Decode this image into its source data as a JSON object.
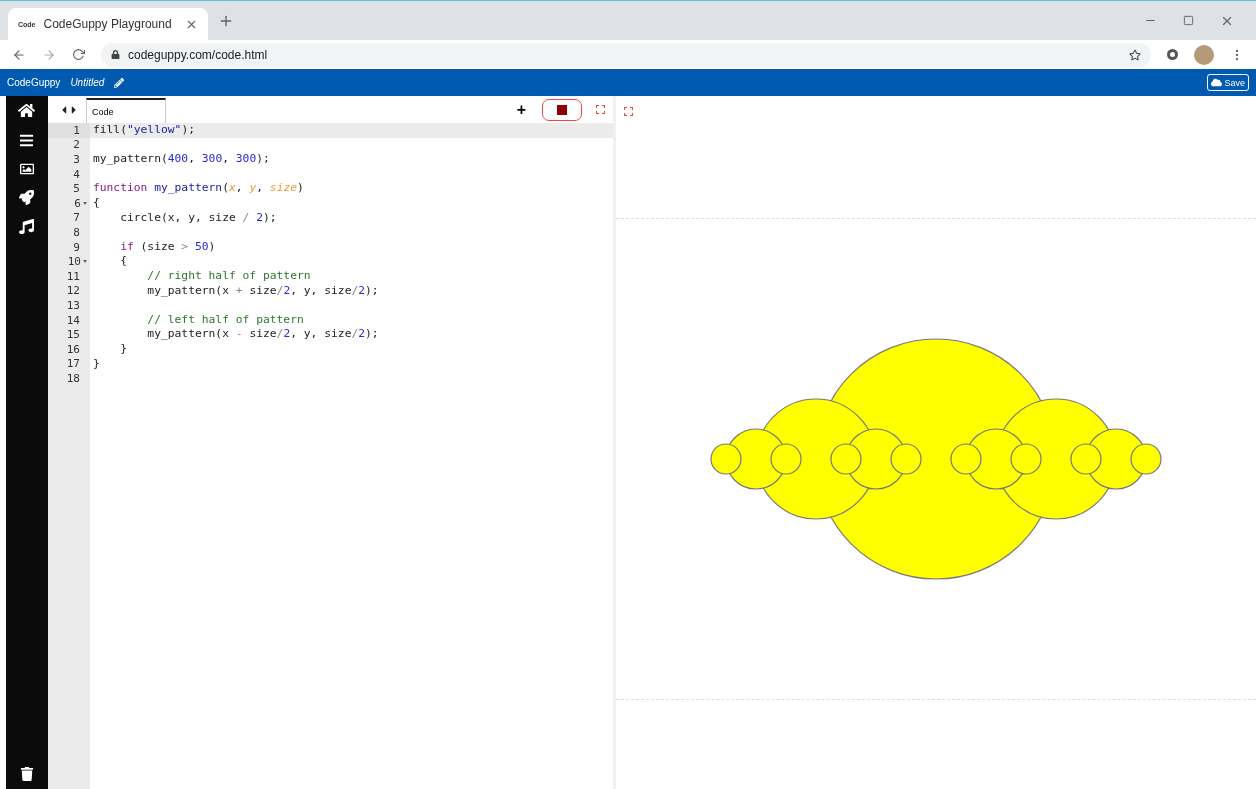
{
  "browser": {
    "tab_title": "CodeGuppy Playground",
    "tab_logo": "Code",
    "url": "codeguppy.com/code.html"
  },
  "app_bar": {
    "brand": "CodeGuppy",
    "project": "Untitled",
    "save_label": "Save"
  },
  "editor": {
    "tabs": [
      {
        "label": "Code",
        "selected": true
      }
    ],
    "add_label": "+",
    "running": true,
    "lines": [
      {
        "number": "1",
        "foldable": false,
        "current": true,
        "tokens": [
          {
            "kind": "plain",
            "text": "fill("
          },
          {
            "kind": "string",
            "text": "\"yellow\""
          },
          {
            "kind": "plain",
            "text": ");"
          }
        ]
      },
      {
        "number": "2",
        "foldable": false,
        "current": false
      },
      {
        "number": "3",
        "foldable": false,
        "current": false,
        "tokens": [
          {
            "kind": "plain",
            "text": "my_pattern("
          },
          {
            "kind": "number",
            "text": "400"
          },
          {
            "kind": "plain",
            "text": ", "
          },
          {
            "kind": "number",
            "text": "300"
          },
          {
            "kind": "plain",
            "text": ", "
          },
          {
            "kind": "number",
            "text": "300"
          },
          {
            "kind": "plain",
            "text": ");"
          }
        ]
      },
      {
        "number": "4",
        "foldable": false,
        "current": false
      },
      {
        "number": "5",
        "foldable": false,
        "current": false,
        "tokens": [
          {
            "kind": "keyword",
            "text": "function"
          },
          {
            "kind": "def",
            "text": " my_pattern"
          },
          {
            "kind": "plain",
            "text": "("
          },
          {
            "kind": "param",
            "text": "x"
          },
          {
            "kind": "plain",
            "text": ", "
          },
          {
            "kind": "param",
            "text": "y"
          },
          {
            "kind": "plain",
            "text": ", "
          },
          {
            "kind": "param",
            "text": "size"
          },
          {
            "kind": "plain",
            "text": ")"
          }
        ]
      },
      {
        "number": "6",
        "foldable": true,
        "current": false,
        "tokens": [
          {
            "kind": "plain",
            "text": "{"
          }
        ]
      },
      {
        "number": "7",
        "foldable": false,
        "current": false,
        "tokens": [
          {
            "kind": "plain",
            "text": "    circle(x, y, size "
          },
          {
            "kind": "operator",
            "text": "/"
          },
          {
            "kind": "number",
            "text": " 2"
          },
          {
            "kind": "plain",
            "text": ");"
          }
        ]
      },
      {
        "number": "8",
        "foldable": false,
        "current": false
      },
      {
        "number": "9",
        "foldable": false,
        "current": false,
        "tokens": [
          {
            "kind": "keyword",
            "text": "    if"
          },
          {
            "kind": "plain",
            "text": " (size "
          },
          {
            "kind": "operator",
            "text": ">"
          },
          {
            "kind": "number",
            "text": " 50"
          },
          {
            "kind": "plain",
            "text": ")"
          }
        ]
      },
      {
        "number": "10",
        "foldable": true,
        "current": false,
        "tokens": [
          {
            "kind": "plain",
            "text": "    {"
          }
        ]
      },
      {
        "number": "11",
        "foldable": false,
        "current": false,
        "tokens": [
          {
            "kind": "comment",
            "text": "        // right half of pattern"
          }
        ]
      },
      {
        "number": "12",
        "foldable": false,
        "current": false,
        "tokens": [
          {
            "kind": "plain",
            "text": "        my_pattern(x "
          },
          {
            "kind": "operator",
            "text": "+"
          },
          {
            "kind": "plain",
            "text": " size"
          },
          {
            "kind": "operator",
            "text": "/"
          },
          {
            "kind": "number",
            "text": "2"
          },
          {
            "kind": "plain",
            "text": ", y, size"
          },
          {
            "kind": "operator",
            "text": "/"
          },
          {
            "kind": "number",
            "text": "2"
          },
          {
            "kind": "plain",
            "text": ");"
          }
        ]
      },
      {
        "number": "13",
        "foldable": false,
        "current": false
      },
      {
        "number": "14",
        "foldable": false,
        "current": false,
        "tokens": [
          {
            "kind": "comment",
            "text": "        // left half of pattern"
          }
        ]
      },
      {
        "number": "15",
        "foldable": false,
        "current": false,
        "tokens": [
          {
            "kind": "plain",
            "text": "        my_pattern(x "
          },
          {
            "kind": "operator",
            "text": "-"
          },
          {
            "kind": "plain",
            "text": " size"
          },
          {
            "kind": "operator",
            "text": "/"
          },
          {
            "kind": "number",
            "text": "2"
          },
          {
            "kind": "plain",
            "text": ", y, size"
          },
          {
            "kind": "operator",
            "text": "/"
          },
          {
            "kind": "number",
            "text": "2"
          },
          {
            "kind": "plain",
            "text": ");"
          }
        ]
      },
      {
        "number": "16",
        "foldable": false,
        "current": false,
        "tokens": [
          {
            "kind": "plain",
            "text": "    }"
          }
        ]
      },
      {
        "number": "17",
        "foldable": false,
        "current": false,
        "tokens": [
          {
            "kind": "plain",
            "text": "}"
          }
        ]
      },
      {
        "number": "18",
        "foldable": false,
        "current": false
      }
    ]
  }
}
